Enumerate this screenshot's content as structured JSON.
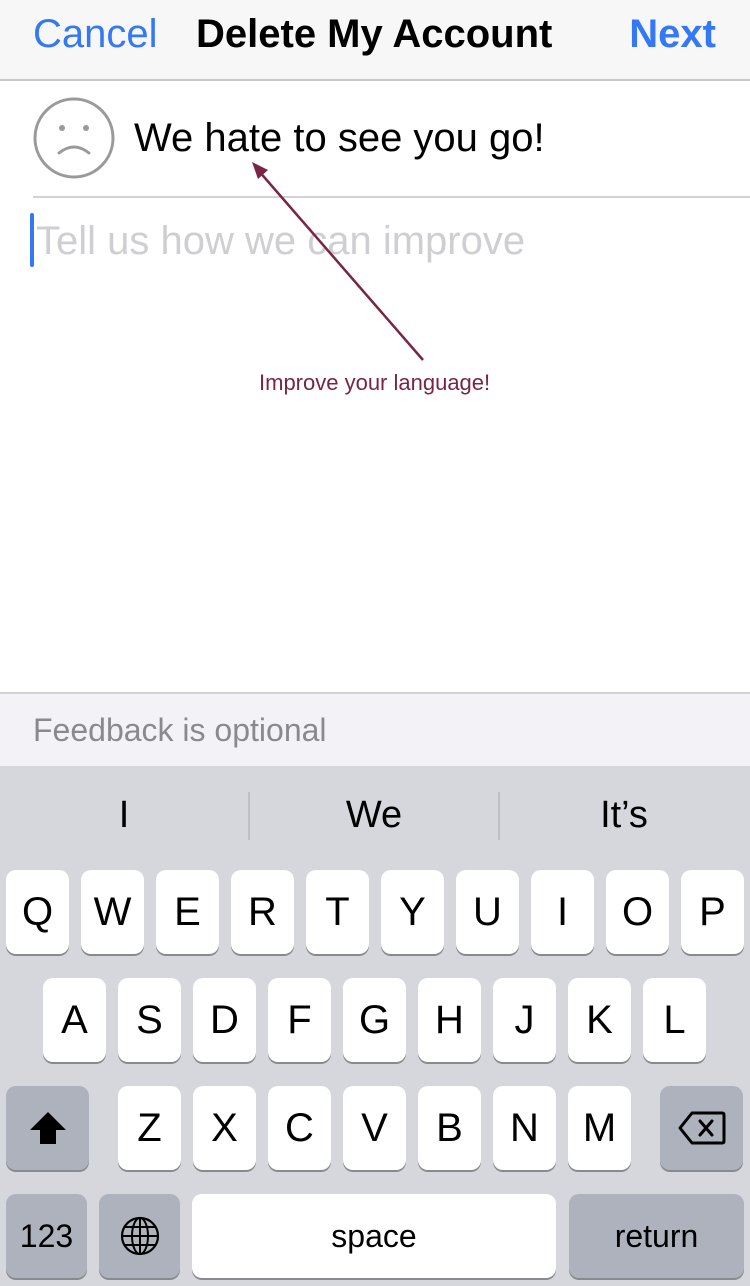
{
  "navbar": {
    "cancel_label": "Cancel",
    "title": "Delete My Account",
    "next_label": "Next"
  },
  "header": {
    "icon": "sad-face-icon",
    "headline": "We hate to see you go!"
  },
  "feedback": {
    "value": "",
    "placeholder": "Tell us how we can improve"
  },
  "annotation": {
    "text": "Improve your language!",
    "color": "#7a2545"
  },
  "footer": {
    "note": "Feedback is optional"
  },
  "keyboard": {
    "suggestions": [
      "I",
      "We",
      "It’s"
    ],
    "rows": [
      [
        "Q",
        "W",
        "E",
        "R",
        "T",
        "Y",
        "U",
        "I",
        "O",
        "P"
      ],
      [
        "A",
        "S",
        "D",
        "F",
        "G",
        "H",
        "J",
        "K",
        "L"
      ],
      [
        "Z",
        "X",
        "C",
        "V",
        "B",
        "N",
        "M"
      ]
    ],
    "shift_icon": "shift-arrow-icon",
    "backspace_icon": "backspace-icon",
    "numbers_label": "123",
    "globe_icon": "globe-icon",
    "space_label": "space",
    "return_label": "return"
  },
  "colors": {
    "accent": "#3478f6",
    "annotation": "#7a2545",
    "keyboard_bg": "#d5d7dc"
  }
}
